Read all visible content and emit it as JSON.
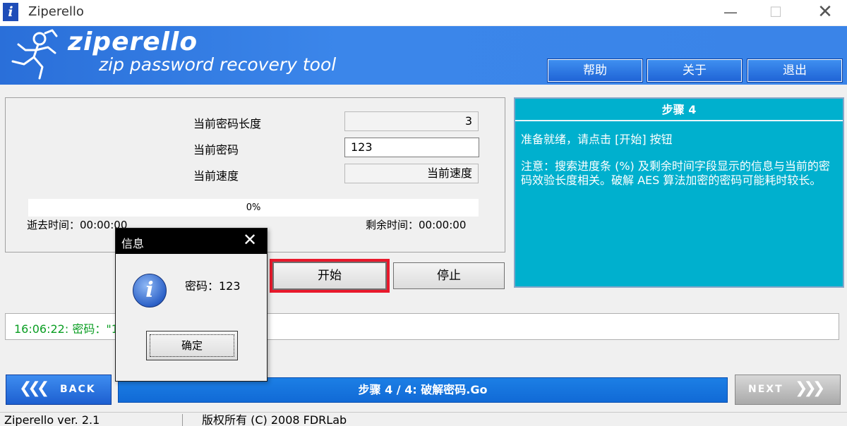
{
  "window": {
    "title": "Ziperello",
    "icon_letter": "i",
    "min_label": "—",
    "max_label": "☐",
    "close_label": "✕"
  },
  "banner": {
    "brand": "ziperello",
    "tagline": "zip password recovery tool",
    "buttons": {
      "help": "帮助",
      "about": "关于",
      "exit": "退出"
    }
  },
  "panel": {
    "length_label": "当前密码长度",
    "length_value": "3",
    "password_label": "当前密码",
    "password_value": "123",
    "speed_label": "当前速度",
    "speed_value": "当前速度",
    "progress": {
      "percent": 0,
      "label": "0%"
    },
    "elapsed_label": "逝去时间：00:00:00",
    "remaining_label": "剩余时间：00:00:00"
  },
  "actions": {
    "start": "开始",
    "stop": "停止"
  },
  "info": {
    "header": "步骤 4",
    "line1": "准备就绪，请点击 [开始] 按钮",
    "line2": "注意：搜索进度条 (%) 及剩余时间字段显示的信息与当前的密码效验长度相关。破解 AES 算法加密的密码可能耗时较长。"
  },
  "log": {
    "text": "16:06:22: 密码：\"123\""
  },
  "nav": {
    "back_label": "BACK",
    "back_arrows": "❮❮❮",
    "step_text": "步骤 4 / 4: 破解密码.Go",
    "next_label": "NEXT",
    "next_arrows": "❯❯❯"
  },
  "status": {
    "version": "Ziperello ver. 2.1",
    "copyright": "版权所有 (C) 2008 FDRLab"
  },
  "dialog": {
    "title": "信息",
    "close": "✕",
    "icon_letter": "i",
    "message": "密码：123",
    "ok": "确定"
  },
  "colors": {
    "banner_blue": "#3b86ea",
    "info_cyan": "#00b0ce",
    "highlight_red": "#e8192c",
    "log_green": "#0a9e22"
  }
}
